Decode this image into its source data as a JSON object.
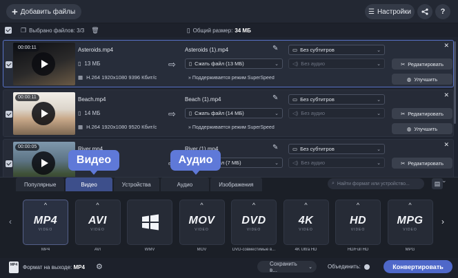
{
  "toolbar": {
    "add_files": "Добавить файлы",
    "settings": "Настройки"
  },
  "summary": {
    "selected": "Выбрано файлов: 3/3",
    "total_label": "Общий размер:",
    "total_value": "34 МБ"
  },
  "files": [
    {
      "duration": "00:00:11",
      "name": "Asteroids.mp4",
      "size": "13 МБ",
      "info": "H.264 1920x1080 9396 Кбит/с",
      "output_name": "Asteroids (1).mp4",
      "subtitles": "Без субтитров",
      "compress": "Сжать файл (13 МБ)",
      "audio": "Без аудио",
      "super": "Поддерживается режим SuperSpeed",
      "edit": "Редактировать",
      "enhance": "Улучшить"
    },
    {
      "duration": "00:00:11",
      "name": "Beach.mp4",
      "size": "14 МБ",
      "info": "H.264 1920x1080 9520 Кбит/с",
      "output_name": "Beach (1).mp4",
      "subtitles": "Без субтитров",
      "compress": "Сжать файл (14 МБ)",
      "audio": "Без аудио",
      "super": "Поддерживается режим SuperSpeed",
      "edit": "Редактировать",
      "enhance": "Улучшить"
    },
    {
      "duration": "00:00:05",
      "name": "River.mp4",
      "output_name": "River (1).mp4",
      "subtitles": "Без субтитров",
      "compress": "Сжать файл (7 МБ)",
      "audio": "Без аудио",
      "edit": "Редактировать"
    }
  ],
  "tooltips": {
    "video": "Видео",
    "audio": "Аудио"
  },
  "tabs": [
    "Популярные",
    "Видео",
    "Устройства",
    "Аудио",
    "Изображения"
  ],
  "search_placeholder": "Найти формат или устройство...",
  "formats": [
    {
      "logo": "MP4",
      "sub": "VIDEO",
      "label": "MP4"
    },
    {
      "logo": "AVI",
      "sub": "VIDEO",
      "label": "AVI"
    },
    {
      "logo": "",
      "sub": "",
      "label": "WMV"
    },
    {
      "logo": "MOV",
      "sub": "VIDEO",
      "label": "MOV"
    },
    {
      "logo": "DVD",
      "sub": "VIDEO",
      "label": "DVD-совместимые в..."
    },
    {
      "logo": "4K",
      "sub": "VIDEO",
      "label": "4K Ultra HD"
    },
    {
      "logo": "HD",
      "sub": "VIDEO",
      "label": "HD/Full HD"
    },
    {
      "logo": "MPG",
      "sub": "VIDEO",
      "label": "MPG"
    }
  ],
  "footer": {
    "badge": "MP4",
    "output_label": "Формат на выходе:",
    "output_value": "MP4",
    "save": "Сохранить в...",
    "merge": "Объединить:",
    "convert": "Конвертировать"
  },
  "colors": {
    "accent": "#4f68c9",
    "tab_active": "#3d4f8b",
    "selected_border": "#5872c8"
  }
}
